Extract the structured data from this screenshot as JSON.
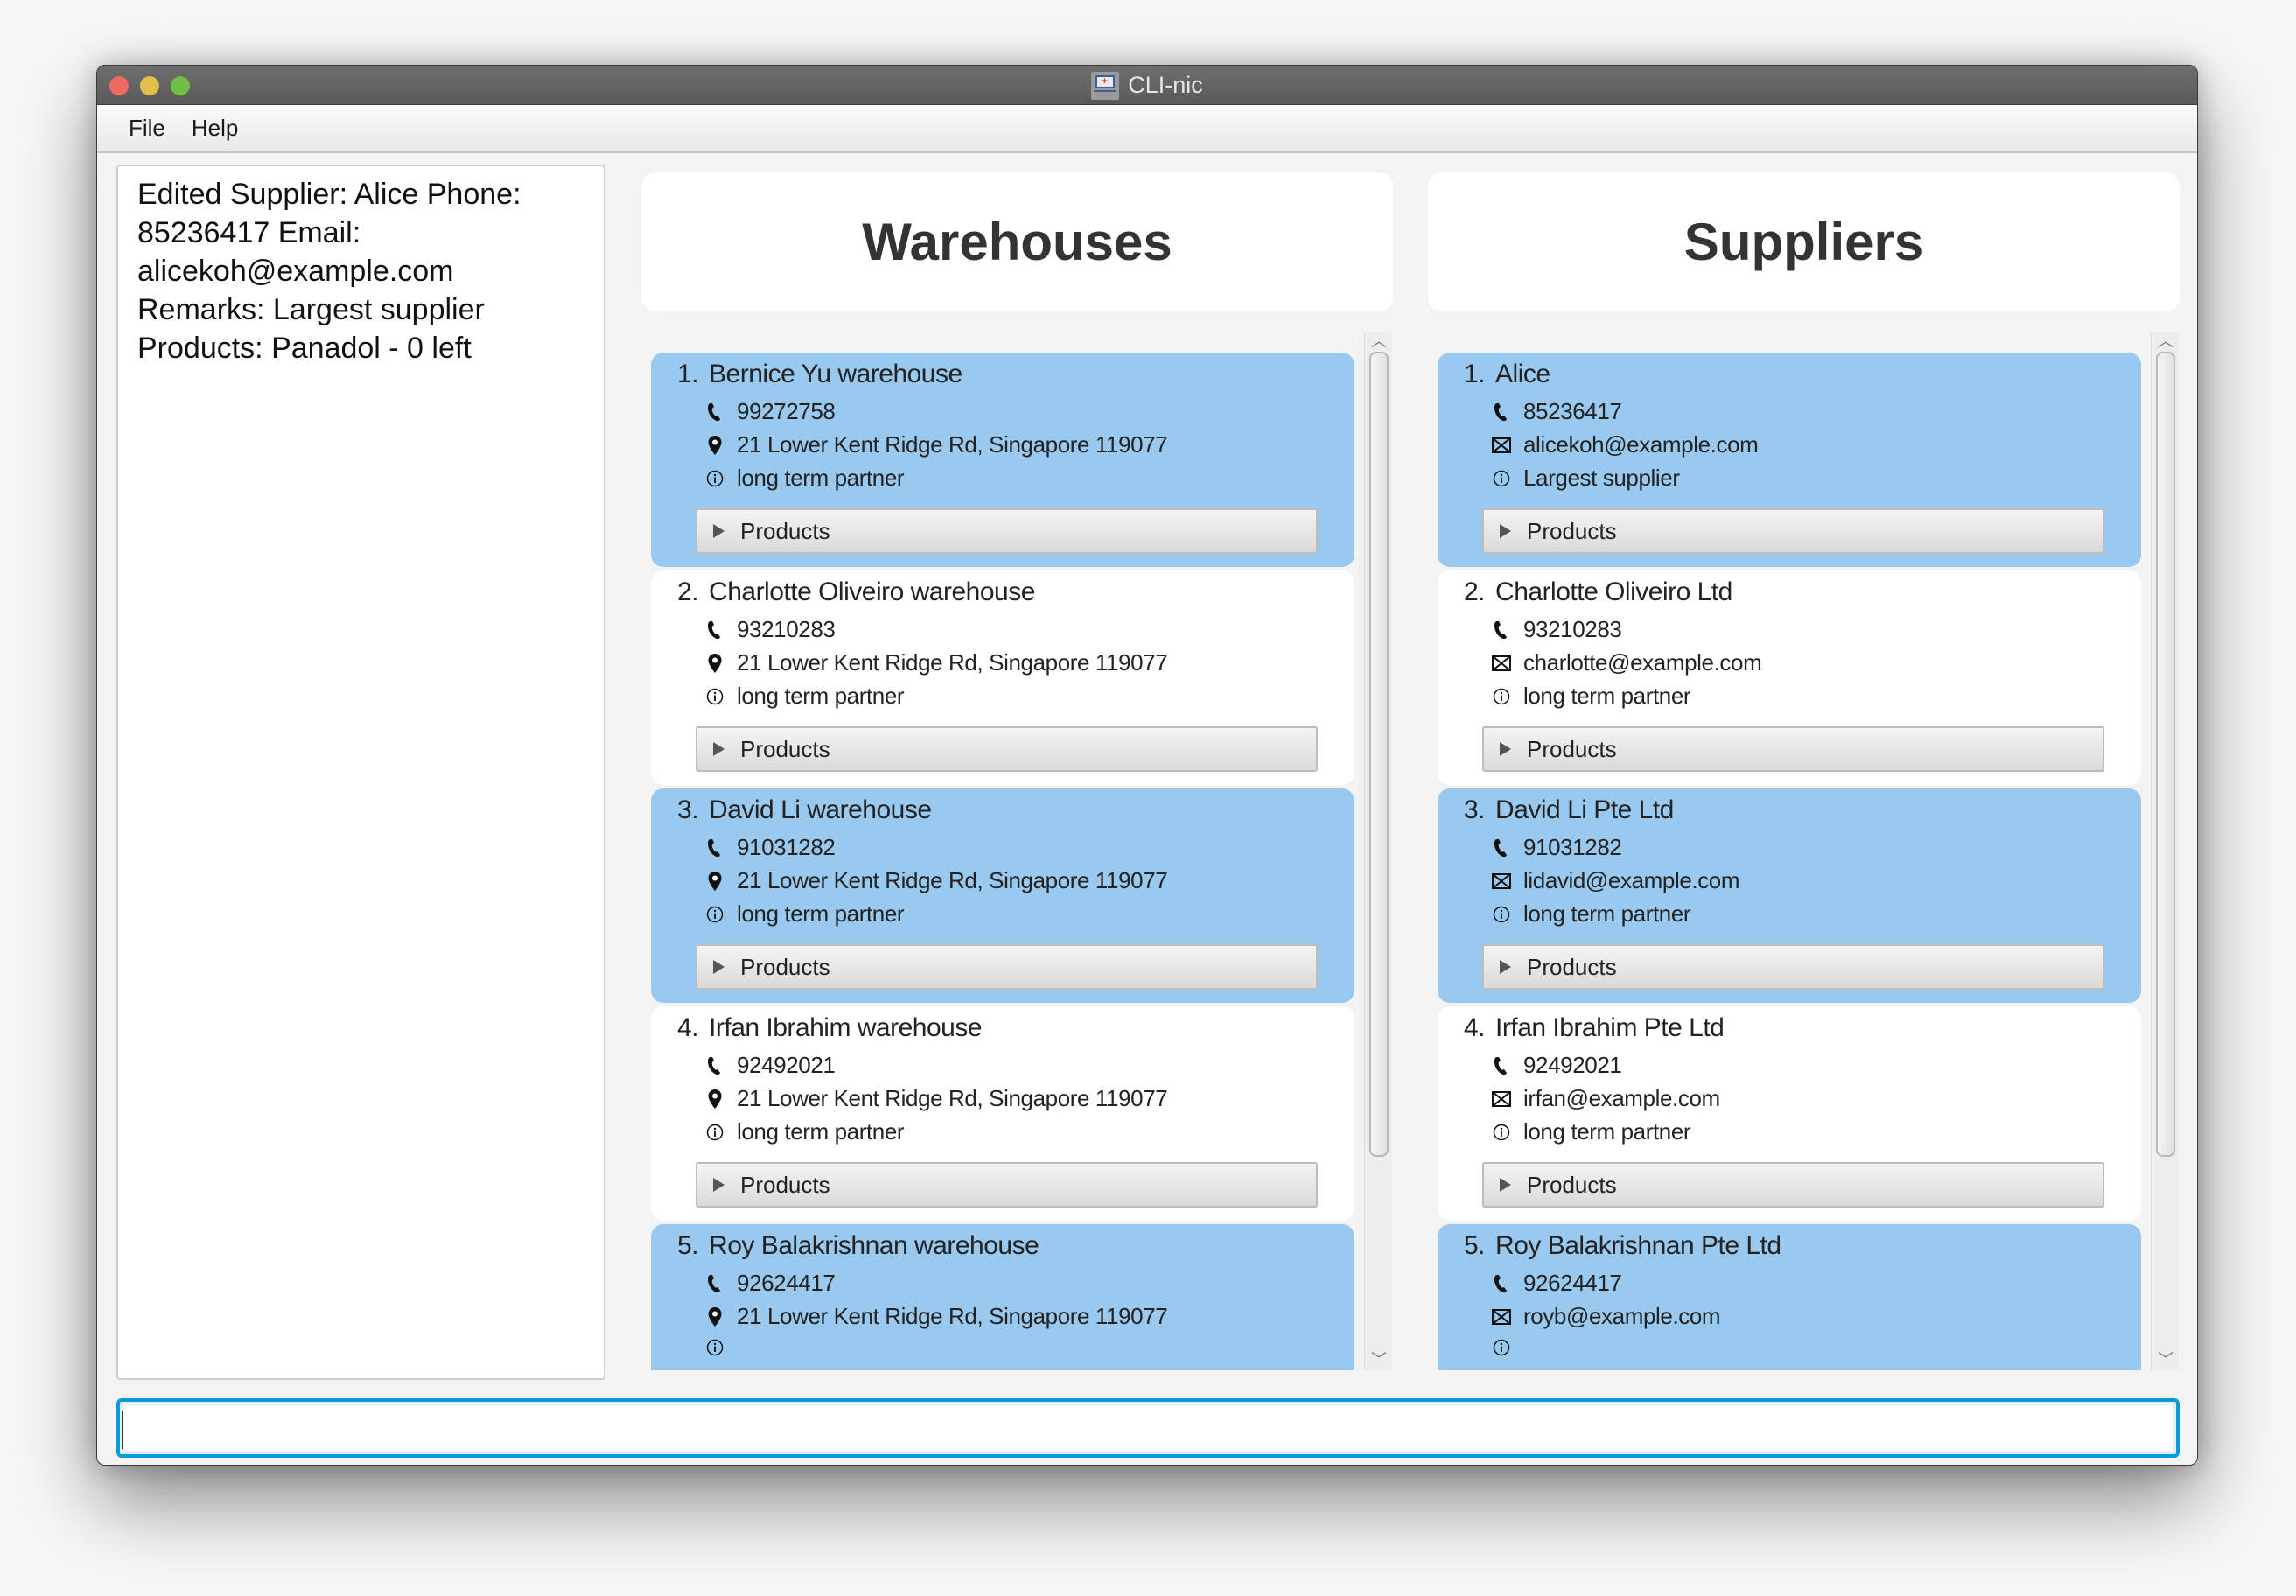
{
  "window": {
    "title": "CLI-nic",
    "app_icon": "cli-nic-app-icon",
    "traffic_lights": [
      "close",
      "minimize",
      "maximize"
    ]
  },
  "menu": {
    "items": [
      {
        "label": "File"
      },
      {
        "label": "Help"
      }
    ]
  },
  "result_display": {
    "text": "Edited Supplier: Alice Phone: 85236417 Email: alicekoh@example.com Remarks: Largest supplier Products: Panadol - 0 left"
  },
  "warehouses": {
    "header": "Warehouses",
    "items": [
      {
        "index": "1.",
        "name": "Bernice Yu warehouse",
        "phone": "99272758",
        "address": "21 Lower Kent Ridge Rd, Singapore 119077",
        "remark": "long term partner",
        "products_label": "Products",
        "selected": true
      },
      {
        "index": "2.",
        "name": "Charlotte Oliveiro warehouse",
        "phone": "93210283",
        "address": "21 Lower Kent Ridge Rd, Singapore 119077",
        "remark": "long term partner",
        "products_label": "Products",
        "selected": false
      },
      {
        "index": "3.",
        "name": "David Li warehouse",
        "phone": "91031282",
        "address": "21 Lower Kent Ridge Rd, Singapore 119077",
        "remark": "long term partner",
        "products_label": "Products",
        "selected": true
      },
      {
        "index": "4.",
        "name": "Irfan Ibrahim warehouse",
        "phone": "92492021",
        "address": "21 Lower Kent Ridge Rd, Singapore 119077",
        "remark": "long term partner",
        "products_label": "Products",
        "selected": false
      },
      {
        "index": "5.",
        "name": "Roy Balakrishnan warehouse",
        "phone": "92624417",
        "address": "21 Lower Kent Ridge Rd, Singapore 119077",
        "remark": "",
        "products_label": "",
        "selected": true
      }
    ]
  },
  "suppliers": {
    "header": "Suppliers",
    "items": [
      {
        "index": "1.",
        "name": "Alice",
        "phone": "85236417",
        "email": "alicekoh@example.com",
        "remark": "Largest supplier",
        "products_label": "Products",
        "selected": true
      },
      {
        "index": "2.",
        "name": "Charlotte Oliveiro Ltd",
        "phone": "93210283",
        "email": "charlotte@example.com",
        "remark": "long term partner",
        "products_label": "Products",
        "selected": false
      },
      {
        "index": "3.",
        "name": "David Li Pte Ltd",
        "phone": "91031282",
        "email": "lidavid@example.com",
        "remark": "long term partner",
        "products_label": "Products",
        "selected": true
      },
      {
        "index": "4.",
        "name": "Irfan Ibrahim Pte Ltd",
        "phone": "92492021",
        "email": "irfan@example.com",
        "remark": "long term partner",
        "products_label": "Products",
        "selected": false
      },
      {
        "index": "5.",
        "name": "Roy Balakrishnan Pte Ltd",
        "phone": "92624417",
        "email": "royb@example.com",
        "remark": "",
        "products_label": "",
        "selected": true
      }
    ]
  },
  "command_box": {
    "value": "",
    "placeholder": ""
  },
  "colors": {
    "selected_card": "#99c9ef",
    "plain_card": "#ffffff",
    "focus_border": "#0a9bd6",
    "titlebar": "#626262"
  }
}
